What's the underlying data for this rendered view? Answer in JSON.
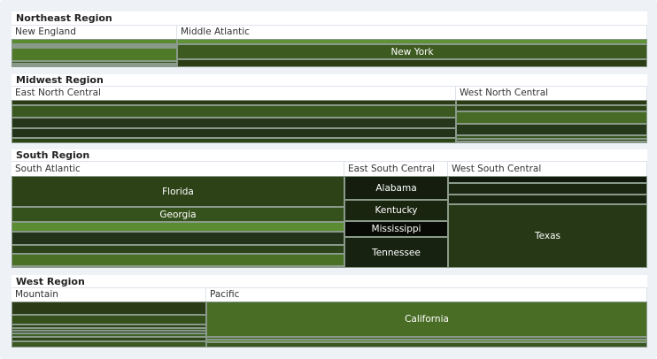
{
  "chart_data": {
    "type": "treemap",
    "regions": [
      {
        "name": "Northeast Region",
        "divisions": [
          {
            "name": "New England",
            "cells": [
              {
                "label": "",
                "color": "#5a8a30"
              },
              {
                "label": "",
                "color": "#2c3f18"
              },
              {
                "label": "",
                "color": "#3c5a20"
              },
              {
                "label": "",
                "color": "#4f7a28"
              },
              {
                "label": "",
                "color": "#3a5720"
              },
              {
                "label": "",
                "color": "#4a7026"
              },
              {
                "label": "",
                "color": "#2e4418"
              }
            ]
          },
          {
            "name": "Middle Atlantic",
            "cells": [
              {
                "label": "",
                "color": "#5f9236"
              },
              {
                "label": "New York",
                "color": "#3d5a20"
              },
              {
                "label": "",
                "color": "#2a3d15"
              }
            ]
          }
        ]
      },
      {
        "name": "Midwest Region",
        "divisions": [
          {
            "name": "East North Central",
            "cells": [
              {
                "label": "",
                "color": "#2a3b14"
              },
              {
                "label": "",
                "color": "#3a5820"
              },
              {
                "label": "",
                "color": "#26361a"
              },
              {
                "label": "",
                "color": "#22331a"
              },
              {
                "label": "",
                "color": "#2d4417"
              }
            ]
          },
          {
            "name": "West North Central",
            "cells": [
              {
                "label": "",
                "color": "#2a3b14"
              },
              {
                "label": "",
                "color": "#2f4418"
              },
              {
                "label": "",
                "color": "#476b26"
              },
              {
                "label": "",
                "color": "#26381a"
              },
              {
                "label": "",
                "color": "#3a5620"
              },
              {
                "label": "",
                "color": "#2c4218"
              },
              {
                "label": "",
                "color": "#40602a"
              }
            ]
          }
        ]
      },
      {
        "name": "South Region",
        "divisions": [
          {
            "name": "South Atlantic",
            "cells": [
              {
                "label": "Florida",
                "color": "#2d4216"
              },
              {
                "label": "Georgia",
                "color": "#36521c"
              },
              {
                "label": "",
                "color": "#5b8c32"
              },
              {
                "label": "",
                "color": "#22331a"
              },
              {
                "label": "",
                "color": "#2c4218"
              },
              {
                "label": "",
                "color": "#4a7026"
              },
              {
                "label": "",
                "color": "#2a3d15"
              }
            ]
          },
          {
            "name": "East South Central",
            "cells": [
              {
                "label": "Alabama",
                "color": "#151e0e"
              },
              {
                "label": "Kentucky",
                "color": "#1a2510"
              },
              {
                "label": "Mississippi",
                "color": "#080a05"
              },
              {
                "label": "Tennessee",
                "color": "#172210"
              }
            ]
          },
          {
            "name": "West South Central",
            "cells": [
              {
                "label": "",
                "color": "#111a0b"
              },
              {
                "label": "",
                "color": "#1b2710"
              },
              {
                "label": "",
                "color": "#1a2610"
              },
              {
                "label": "Texas",
                "color": "#263816"
              }
            ]
          }
        ]
      },
      {
        "name": "West Region",
        "divisions": [
          {
            "name": "Mountain",
            "cells": [
              {
                "label": "",
                "color": "#2a3b16"
              },
              {
                "label": "",
                "color": "#36501c"
              },
              {
                "label": "",
                "color": "#2c4218"
              },
              {
                "label": "",
                "color": "#3a5620"
              },
              {
                "label": "",
                "color": "#26381a"
              },
              {
                "label": "",
                "color": "#40602a"
              },
              {
                "label": "",
                "color": "#2d4417"
              },
              {
                "label": "",
                "color": "#3a5820"
              }
            ]
          },
          {
            "name": "Pacific",
            "cells": [
              {
                "label": "California",
                "color": "#4a6d25"
              },
              {
                "label": "",
                "color": "#3d5a20"
              },
              {
                "label": "",
                "color": "#5a8a30"
              },
              {
                "label": "",
                "color": "#3a5620"
              }
            ]
          }
        ]
      }
    ]
  }
}
